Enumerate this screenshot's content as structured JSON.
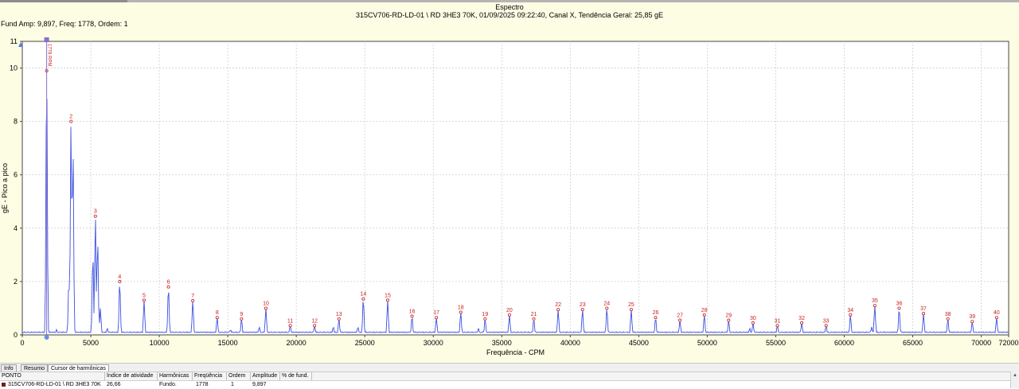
{
  "header": {
    "title": "Espectro",
    "subtitle": "315CV706-RD-LD-01 \\ RD   3HE3 70K, 01/09/2025 09:22:40, Canal X, Tendência Geral: 25,85 gE",
    "fund_amp": "Fund Amp: 9,897, Freq: 1778, Ordem: 1"
  },
  "colors": {
    "spectrum": "#3c4fe0",
    "harmonic": "#c81e1e",
    "cursor": "#8a6fc9",
    "background": "#fdfde4",
    "plot_bg": "#ffffff"
  },
  "chart_data": {
    "type": "line",
    "xlabel": "Frequência - CPM",
    "ylabel": "gE - Pico a pico",
    "xlim": [
      0,
      72000
    ],
    "ylim": [
      0,
      11
    ],
    "x_ticks": [
      0,
      5000,
      10000,
      15000,
      20000,
      25000,
      30000,
      35000,
      40000,
      45000,
      50000,
      55000,
      60000,
      65000,
      70000,
      72000
    ],
    "y_ticks": [
      0,
      2,
      4,
      6,
      8,
      10,
      11
    ],
    "grid": true,
    "cursor_label": "1778 RPM",
    "fundamental": 1778,
    "noise_floor": 0.12,
    "harmonics": [
      {
        "order": 1,
        "freq": 1778,
        "amp": 9.897,
        "label": ""
      },
      {
        "order": 2,
        "freq": 3556,
        "amp": 8.0,
        "label": "2"
      },
      {
        "order": 3,
        "freq": 5334,
        "amp": 4.45,
        "label": "3"
      },
      {
        "order": 4,
        "freq": 7112,
        "amp": 2.0,
        "label": "4"
      },
      {
        "order": 5,
        "freq": 8890,
        "amp": 1.3,
        "label": "5"
      },
      {
        "order": 6,
        "freq": 10668,
        "amp": 1.8,
        "label": "6"
      },
      {
        "order": 7,
        "freq": 12446,
        "amp": 1.28,
        "label": "7"
      },
      {
        "order": 8,
        "freq": 14224,
        "amp": 0.65,
        "label": "8"
      },
      {
        "order": 9,
        "freq": 16002,
        "amp": 0.6,
        "label": "9"
      },
      {
        "order": 10,
        "freq": 17780,
        "amp": 1.0,
        "label": "10"
      },
      {
        "order": 11,
        "freq": 19558,
        "amp": 0.35,
        "label": "11"
      },
      {
        "order": 12,
        "freq": 21336,
        "amp": 0.35,
        "label": "12"
      },
      {
        "order": 13,
        "freq": 23114,
        "amp": 0.6,
        "label": "13"
      },
      {
        "order": 14,
        "freq": 24892,
        "amp": 1.35,
        "label": "14"
      },
      {
        "order": 15,
        "freq": 26670,
        "amp": 1.3,
        "label": "15"
      },
      {
        "order": 16,
        "freq": 28448,
        "amp": 0.7,
        "label": "16"
      },
      {
        "order": 17,
        "freq": 30226,
        "amp": 0.65,
        "label": "17"
      },
      {
        "order": 18,
        "freq": 32004,
        "amp": 0.85,
        "label": "18"
      },
      {
        "order": 19,
        "freq": 33782,
        "amp": 0.6,
        "label": "19"
      },
      {
        "order": 20,
        "freq": 35560,
        "amp": 0.75,
        "label": "20"
      },
      {
        "order": 21,
        "freq": 37338,
        "amp": 0.6,
        "label": "21"
      },
      {
        "order": 22,
        "freq": 39116,
        "amp": 0.95,
        "label": "22"
      },
      {
        "order": 23,
        "freq": 40894,
        "amp": 0.95,
        "label": "23"
      },
      {
        "order": 24,
        "freq": 42672,
        "amp": 1.0,
        "label": "24"
      },
      {
        "order": 25,
        "freq": 44450,
        "amp": 0.95,
        "label": "25"
      },
      {
        "order": 26,
        "freq": 46228,
        "amp": 0.65,
        "label": "26"
      },
      {
        "order": 27,
        "freq": 48006,
        "amp": 0.55,
        "label": "27"
      },
      {
        "order": 28,
        "freq": 49784,
        "amp": 0.75,
        "label": "28"
      },
      {
        "order": 29,
        "freq": 51562,
        "amp": 0.55,
        "label": "29"
      },
      {
        "order": 30,
        "freq": 53340,
        "amp": 0.45,
        "label": "30"
      },
      {
        "order": 31,
        "freq": 55118,
        "amp": 0.35,
        "label": "31"
      },
      {
        "order": 32,
        "freq": 56896,
        "amp": 0.45,
        "label": "32"
      },
      {
        "order": 33,
        "freq": 58674,
        "amp": 0.35,
        "label": "33"
      },
      {
        "order": 34,
        "freq": 60452,
        "amp": 0.75,
        "label": "34"
      },
      {
        "order": 35,
        "freq": 62230,
        "amp": 1.1,
        "label": "35"
      },
      {
        "order": 36,
        "freq": 64008,
        "amp": 1.0,
        "label": "36"
      },
      {
        "order": 37,
        "freq": 65786,
        "amp": 0.8,
        "label": "37"
      },
      {
        "order": 38,
        "freq": 67564,
        "amp": 0.6,
        "label": "38"
      },
      {
        "order": 39,
        "freq": 69342,
        "amp": 0.5,
        "label": "39"
      },
      {
        "order": 40,
        "freq": 71120,
        "amp": 0.65,
        "label": "40"
      }
    ],
    "extra_peaks": [
      {
        "freq": 3700,
        "amp": 7.1
      },
      {
        "freq": 5500,
        "amp": 3.6
      },
      {
        "freq": 5150,
        "amp": 3.0
      },
      {
        "freq": 3400,
        "amp": 2.0
      },
      {
        "freq": 5700,
        "amp": 1.0
      },
      {
        "freq": 2500,
        "amp": 0.2
      },
      {
        "freq": 6200,
        "amp": 0.25
      },
      {
        "freq": 15200,
        "amp": 0.2
      },
      {
        "freq": 17300,
        "amp": 0.3
      },
      {
        "freq": 22700,
        "amp": 0.3
      },
      {
        "freq": 24500,
        "amp": 0.3
      },
      {
        "freq": 33300,
        "amp": 0.25
      },
      {
        "freq": 53100,
        "amp": 0.25
      },
      {
        "freq": 62000,
        "amp": 0.3
      }
    ]
  },
  "tabs": [
    {
      "label": "Info",
      "active": false
    },
    {
      "label": "Resumo",
      "active": false
    },
    {
      "label": "Cursor de harmônicas",
      "active": true
    }
  ],
  "table": {
    "columns": [
      "PONTO",
      "Índice de atividade",
      "Harmônicas",
      "Freqüência",
      "Ordem",
      "Amplitude",
      "% de fund."
    ],
    "rows": [
      [
        "315CV706-RD-LD-01 \\ RD  3HE3 70K",
        "26,66",
        "Fundo.",
        "1778",
        "1",
        "9,897",
        ""
      ]
    ]
  }
}
